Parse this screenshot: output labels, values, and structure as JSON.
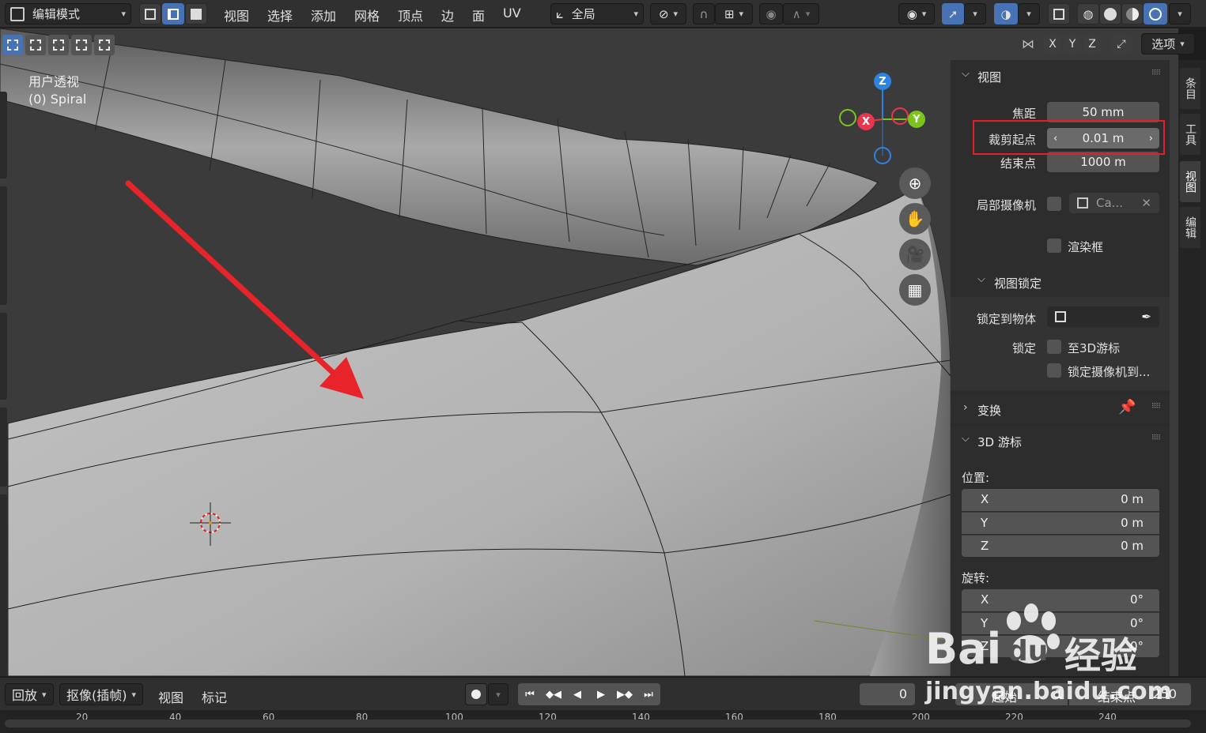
{
  "header": {
    "mode_label": "编辑模式",
    "menus": [
      "视图",
      "选择",
      "添加",
      "网格",
      "顶点",
      "边",
      "面",
      "UV"
    ],
    "orientation_label": "全局",
    "options_label": "选项",
    "axis_x": "X",
    "axis_y": "Y",
    "axis_z": "Z"
  },
  "viewport": {
    "view_name": "用户透视",
    "object_name": "(0) Spiral",
    "gizmo": {
      "z": "Z",
      "x": "X",
      "y": "Y"
    }
  },
  "npanel": {
    "view_section": {
      "title": "视图",
      "focal_label": "焦距",
      "focal_value": "50 mm",
      "clip_start_label": "裁剪起点",
      "clip_start_value": "0.01 m",
      "clip_end_label": "结束点",
      "clip_end_value": "1000 m",
      "local_camera_label": "局部摄像机",
      "local_camera_value": "Ca...",
      "render_region_label": "渲染框"
    },
    "view_lock": {
      "title": "视图锁定",
      "lock_to_object_label": "锁定到物体",
      "lock_label": "锁定",
      "to_3d_cursor_label": "至3D游标",
      "lock_camera_label": "锁定摄像机到..."
    },
    "transform_section": {
      "title": "变换"
    },
    "cursor_section": {
      "title": "3D 游标",
      "location_label": "位置:",
      "location": [
        {
          "axis": "X",
          "value": "0 m"
        },
        {
          "axis": "Y",
          "value": "0 m"
        },
        {
          "axis": "Z",
          "value": "0 m"
        }
      ],
      "rotation_label": "旋转:",
      "rotation": [
        {
          "axis": "X",
          "value": "0°"
        },
        {
          "axis": "Y",
          "value": "0°"
        },
        {
          "axis": "Z",
          "value": "0°"
        }
      ]
    },
    "tabs": [
      "条目",
      "工具",
      "视图",
      "编辑"
    ]
  },
  "timeline": {
    "playback_label": "回放",
    "keying_label": "抠像(插帧)",
    "view_label": "视图",
    "marker_label": "标记",
    "current_frame": "0",
    "start_label": "起始",
    "start_value": "1",
    "end_label": "结束点",
    "end_value": "250",
    "ticks": [
      "20",
      "40",
      "60",
      "80",
      "100",
      "120",
      "140",
      "160",
      "180",
      "200",
      "220",
      "240"
    ]
  },
  "watermark": {
    "brand": "Bai",
    "brand2": "du",
    "product": "经验",
    "url": "jingyan.baidu.com"
  },
  "colors": {
    "accent": "#4772b3",
    "highlight_box": "#e0202a",
    "arrow": "#e8232a",
    "gizmo_x": "#e8364e",
    "gizmo_y": "#7ac41d",
    "gizmo_z": "#2f83e0"
  }
}
